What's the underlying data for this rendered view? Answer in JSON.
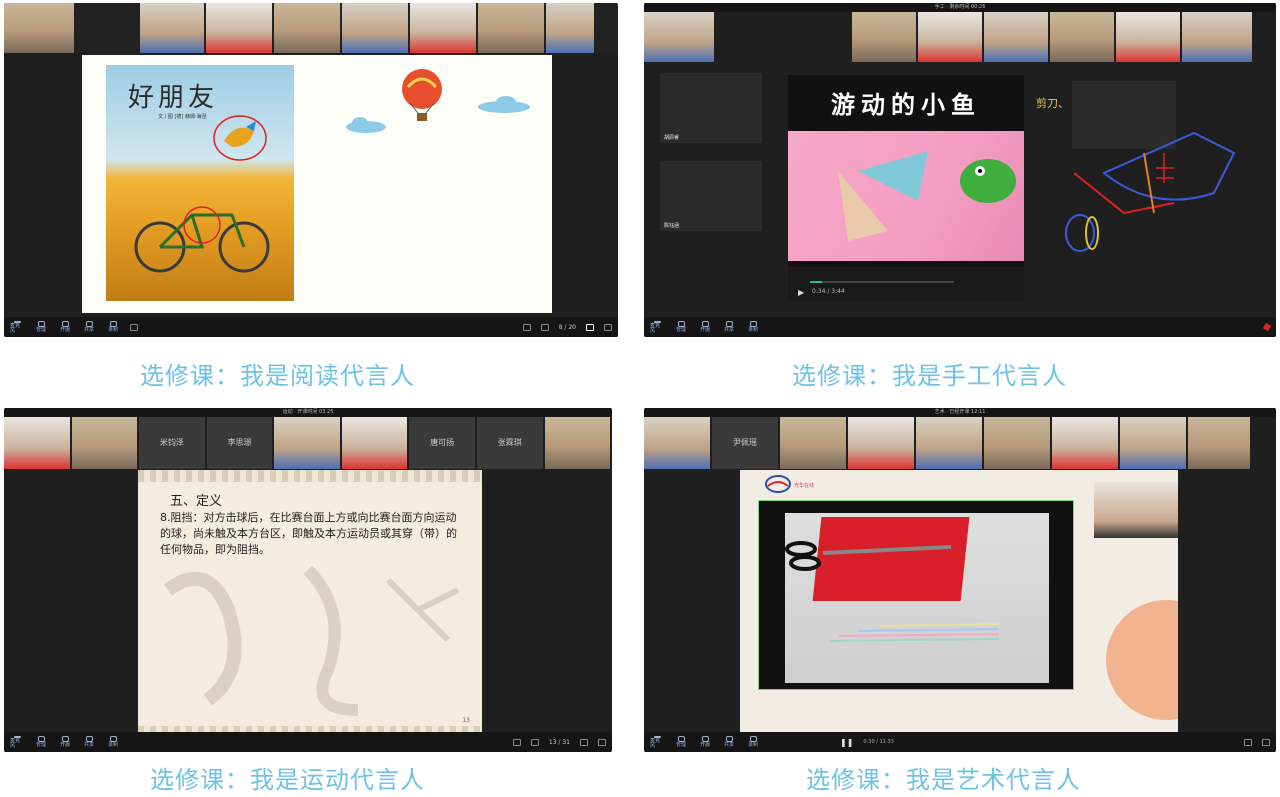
{
  "captions": {
    "p1": "选修课：我是阅读代言人",
    "p2": "选修课：我是手工代言人",
    "p3": "选修课：我是运动代言人",
    "p4": "选修课：我是艺术代言人"
  },
  "panel1": {
    "book_title": "好朋友",
    "book_authors": "文 / 图 [德] 赫姆·海涅",
    "page_indicator": "8 / 20",
    "toolbar": [
      "麦克风",
      "管理",
      "开摄",
      "共享",
      "录制"
    ]
  },
  "panel2": {
    "top_title": "手工 · 剩余时间 00:26",
    "video_title": "游动的小鱼",
    "video_time": "0:34 / 3:44",
    "video_progress": 0.08,
    "hint_text": "剪刀、",
    "side_names": [
      "胡辰睿",
      "陈钰涵"
    ],
    "toolbar": [
      "麦克风",
      "管理",
      "开摄",
      "共享",
      "录制"
    ]
  },
  "panel3": {
    "top_title": "运动 · 开课时间 03:25",
    "thumb_names": [
      "米钧泽",
      "李思璟",
      "唐可扬",
      "张霖琪"
    ],
    "heading": "五、定义",
    "body": "8.阻挡：对方击球后，在比赛台面上方或向比赛台面方向运动的球，尚未触及本方台区，即触及本方运动员或其穿（带）的任何物品，即为阻挡。",
    "page_number": "13",
    "page_indicator": "13 / 31",
    "toolbar": [
      "麦克风",
      "管理",
      "开摄",
      "共享",
      "录制"
    ]
  },
  "panel4": {
    "top_title": "艺术 · 已经开课 12:11",
    "logo_text": "光华在线",
    "video_time": "0:30 / 11:33",
    "thumb_names": [
      "尹佩瑶"
    ],
    "toolbar": [
      "麦克风",
      "管理",
      "开摄",
      "共享",
      "录制"
    ]
  }
}
